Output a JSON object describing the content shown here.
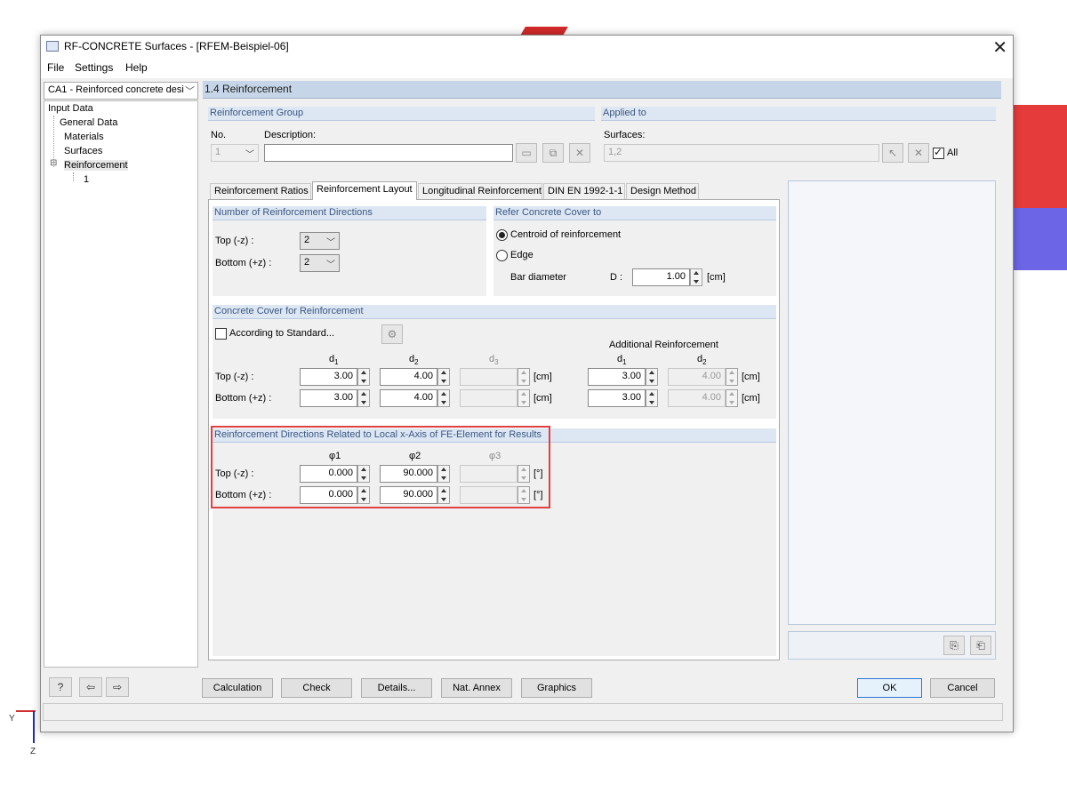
{
  "window": {
    "title": "RF-CONCRETE Surfaces - [RFEM-Beispiel-06]",
    "close_glyph": "✕"
  },
  "menu": [
    "File",
    "Settings",
    "Help"
  ],
  "case_selector": "CA1 - Reinforced concrete desi",
  "tree": {
    "root": "Input Data",
    "items": [
      "General Data",
      "Materials",
      "Surfaces",
      "Reinforcement"
    ],
    "collapse_glyph": "⊟",
    "sub_item": "1"
  },
  "panel_title": "1.4 Reinforcement",
  "reinforcement_group": {
    "title": "Reinforcement Group",
    "no_label": "No.",
    "no_value": "1",
    "description_label": "Description:",
    "description_value": ""
  },
  "applied_to": {
    "title": "Applied to",
    "surfaces_label": "Surfaces:",
    "surfaces_value": "1,2",
    "all_label": "All",
    "all_checked": true
  },
  "tabs": [
    "Reinforcement Ratios",
    "Reinforcement Layout",
    "Longitudinal Reinforcement",
    "DIN EN 1992-1-1",
    "Design Method"
  ],
  "active_tab": "Reinforcement Layout",
  "directions": {
    "title": "Number of Reinforcement Directions",
    "top_label": "Top (-z) :",
    "top_value": "2",
    "bottom_label": "Bottom (+z) :",
    "bottom_value": "2"
  },
  "cover_ref": {
    "title": "Refer Concrete Cover to",
    "option1": "Centroid of reinforcement",
    "option2": "Edge",
    "selected": "Centroid of reinforcement",
    "bar_label": "Bar diameter",
    "d_label": "D :",
    "d_value": "1.00",
    "unit": "[cm]"
  },
  "concrete_cover": {
    "title": "Concrete Cover for Reinforcement",
    "according_label": "According to Standard...",
    "additional_label": "Additional Reinforcement",
    "col_d1": "d",
    "col_d2": "d",
    "col_d3": "d",
    "sub1": "1",
    "sub2": "2",
    "sub3": "3",
    "top_label": "Top (-z) :",
    "bottom_label": "Bottom (+z) :",
    "top_d1": "3.00",
    "top_d2": "4.00",
    "bottom_d1": "3.00",
    "bottom_d2": "4.00",
    "add_top_d1": "3.00",
    "add_top_d2": "4.00",
    "add_bottom_d1": "3.00",
    "add_bottom_d2": "4.00",
    "unit": "[cm]"
  },
  "angles": {
    "title": "Reinforcement Directions Related to Local x-Axis of FE-Element for Results",
    "phi1": "φ1",
    "phi2": "φ2",
    "phi3": "φ3",
    "top_label": "Top (-z) :",
    "bottom_label": "Bottom (+z) :",
    "top_phi1": "0.000",
    "top_phi2": "90.000",
    "bottom_phi1": "0.000",
    "bottom_phi2": "90.000",
    "unit": "[°]"
  },
  "buttons": {
    "calculation": "Calculation",
    "check": "Check",
    "details": "Details...",
    "nat_annex": "Nat. Annex",
    "graphics": "Graphics",
    "ok": "OK",
    "cancel": "Cancel"
  },
  "axes": {
    "y": "Y",
    "z": "Z"
  },
  "colors": {
    "highlight": "#e04040",
    "header": "#c6d6e8",
    "group_title": "#3a5683"
  }
}
